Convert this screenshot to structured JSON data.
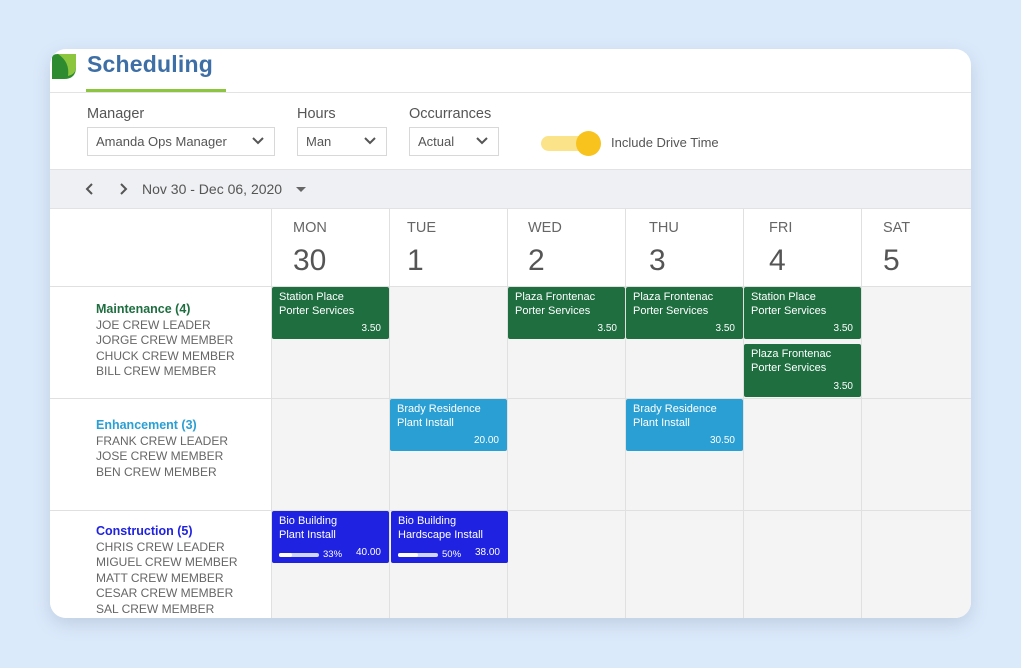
{
  "app": {
    "title": "Scheduling",
    "brand_color": "#3d6fa6",
    "accent": "#8cc63f"
  },
  "filters": {
    "manager": {
      "label": "Manager",
      "value": "Amanda Ops Manager"
    },
    "hours": {
      "label": "Hours",
      "value": "Man"
    },
    "occurrances": {
      "label": "Occurrances",
      "value": "Actual"
    },
    "drive_time": {
      "label": "Include Drive Time",
      "on": true
    }
  },
  "week": {
    "range": "Nov 30 - Dec 06, 2020"
  },
  "days": [
    {
      "name": "MON",
      "num": "30"
    },
    {
      "name": "TUE",
      "num": "1"
    },
    {
      "name": "WED",
      "num": "2"
    },
    {
      "name": "THU",
      "num": "3"
    },
    {
      "name": "FRI",
      "num": "4"
    },
    {
      "name": "SAT",
      "num": "5"
    }
  ],
  "crews": [
    {
      "team": "Maintenance (4)",
      "color": "#1e6e40",
      "members": [
        "JOE CREW LEADER",
        "JORGE CREW MEMBER",
        "CHUCK CREW MEMBER",
        "BILL CREW MEMBER"
      ]
    },
    {
      "team": "Enhancement (3)",
      "color": "#2a9fd3",
      "members": [
        "FRANK CREW LEADER",
        "JOSE CREW MEMBER",
        "BEN CREW MEMBER"
      ]
    },
    {
      "team": "Construction (5)",
      "color": "#1f22e0",
      "members": [
        "CHRIS CREW LEADER",
        "MIGUEL CREW MEMBER",
        "MATT CREW MEMBER",
        "CESAR CREW MEMBER",
        "SAL CREW MEMBER"
      ]
    }
  ],
  "jobs": [
    {
      "line1": "Station Place",
      "line2": "Porter Services",
      "hours": "3.50"
    },
    {
      "line1": "Plaza Frontenac",
      "line2": "Porter Services",
      "hours": "3.50"
    },
    {
      "line1": "Plaza Frontenac",
      "line2": "Porter Services",
      "hours": "3.50"
    },
    {
      "line1": "Station Place",
      "line2": "Porter Services",
      "hours": "3.50"
    },
    {
      "line1": "Plaza Frontenac",
      "line2": "Porter Services",
      "hours": "3.50"
    },
    {
      "line1": "Brady Residence",
      "line2": "Plant Install",
      "hours": "20.00"
    },
    {
      "line1": "Brady Residence",
      "line2": "Plant Install",
      "hours": "30.50"
    },
    {
      "line1": "Bio Building",
      "line2": "Plant Install",
      "hours": "40.00",
      "progress": 0.33,
      "progress_label": "33%"
    },
    {
      "line1": "Bio Building",
      "line2": "Hardscape Install",
      "hours": "38.00",
      "progress": 0.5,
      "progress_label": "50%"
    }
  ]
}
